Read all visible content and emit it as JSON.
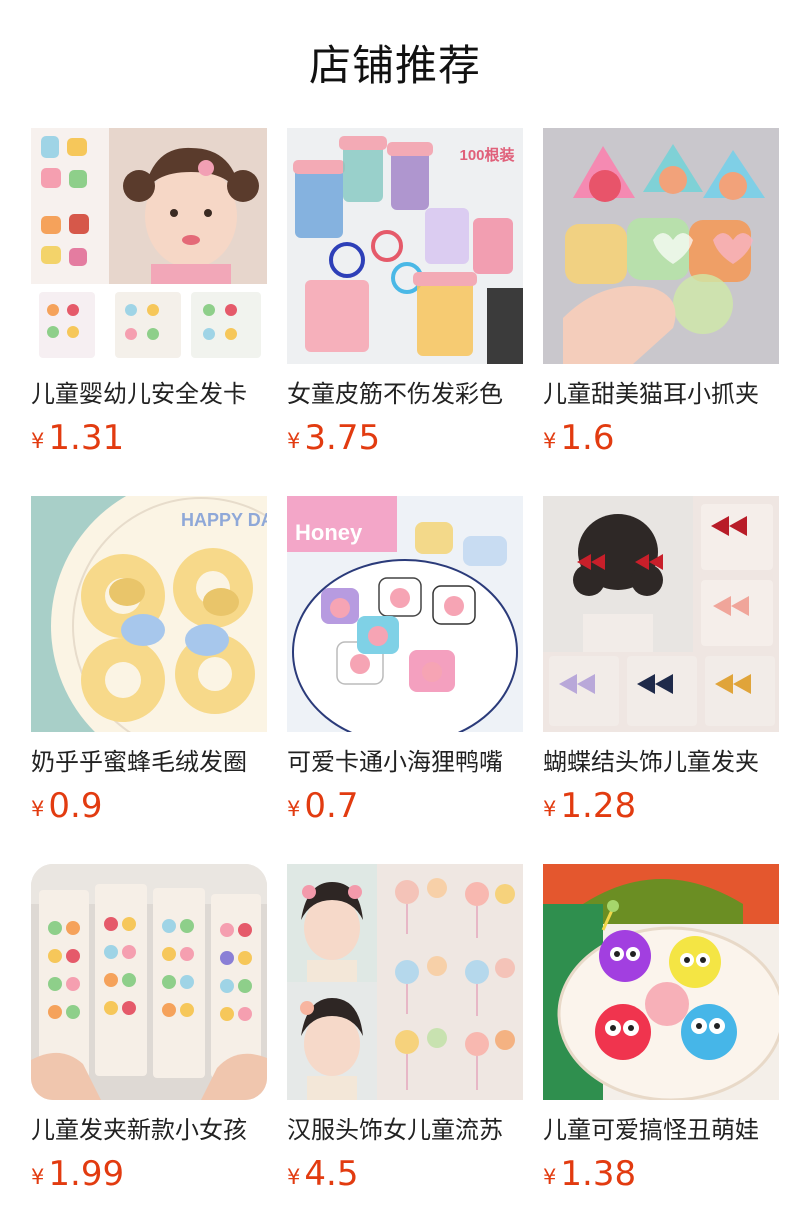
{
  "section": {
    "title": "店铺推荐"
  },
  "products": [
    {
      "name": "儿童婴幼儿安全发卡",
      "currency": "¥",
      "price": "1.31",
      "image": "kids-hair-clips-photo"
    },
    {
      "name": "女童皮筋不伤发彩色",
      "currency": "¥",
      "price": "3.75",
      "image": "hair-ties-jars-photo",
      "image_text": "100根装"
    },
    {
      "name": "儿童甜美猫耳小抓夹",
      "currency": "¥",
      "price": "1.6",
      "image": "cat-ear-claw-clips-photo"
    },
    {
      "name": "奶乎乎蜜蜂毛绒发圈",
      "currency": "¥",
      "price": "0.9",
      "image": "bee-plush-scrunchies-photo",
      "image_text": "HAPPY DAY"
    },
    {
      "name": "可爱卡通小海狸鸭嘴",
      "currency": "¥",
      "price": "0.7",
      "image": "cartoon-beaver-clips-photo",
      "image_text": "Honey"
    },
    {
      "name": "蝴蝶结头饰儿童发夹",
      "currency": "¥",
      "price": "1.28",
      "image": "bow-hair-clips-photo"
    },
    {
      "name": "儿童发夹新款小女孩",
      "currency": "¥",
      "price": "1.99",
      "image": "fruit-clip-cards-photo"
    },
    {
      "name": "汉服头饰女儿童流苏",
      "currency": "¥",
      "price": "4.5",
      "image": "hanfu-tassel-hairpins-photo"
    },
    {
      "name": "儿童可爱搞怪丑萌娃",
      "currency": "¥",
      "price": "1.38",
      "image": "fluffy-monster-clips-photo"
    }
  ]
}
